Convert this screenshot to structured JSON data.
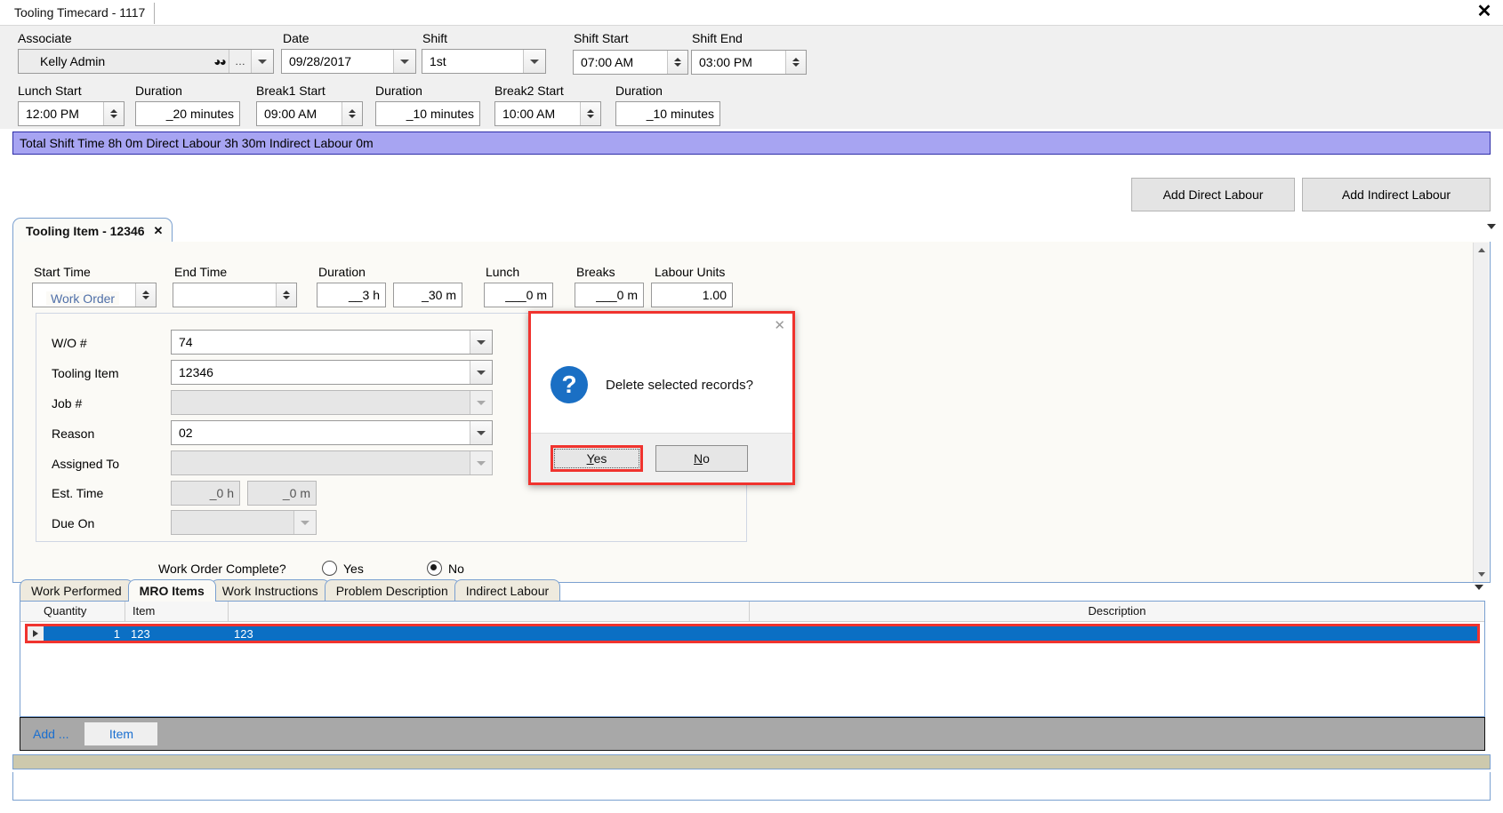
{
  "window": {
    "doc_tab_label": "Tooling Timecard - 1117",
    "close_icon": "close-icon"
  },
  "header": {
    "associate": {
      "label": "Associate",
      "value": "Kelly Admin"
    },
    "date": {
      "label": "Date",
      "value": "09/28/2017"
    },
    "shift": {
      "label": "Shift",
      "value": "1st"
    },
    "shift_start": {
      "label": "Shift Start",
      "value": "07:00 AM"
    },
    "shift_end": {
      "label": "Shift End",
      "value": "03:00 PM"
    },
    "lunch_start": {
      "label": "Lunch Start",
      "value": "12:00 PM"
    },
    "lunch_duration": {
      "label": "Duration",
      "value": "_20 minutes"
    },
    "break1_start": {
      "label": "Break1 Start",
      "value": "09:00 AM"
    },
    "break1_duration": {
      "label": "Duration",
      "value": "_10 minutes"
    },
    "break2_start": {
      "label": "Break2 Start",
      "value": "10:00 AM"
    },
    "break2_duration": {
      "label": "Duration",
      "value": "_10 minutes"
    }
  },
  "summary_banner": {
    "text": "Total Shift Time 8h 0m  Direct Labour 3h 30m  Indirect Labour 0m",
    "background": "#a7a4f2",
    "border": "#2e2ea8"
  },
  "actions": {
    "add_direct_labour": "Add Direct Labour",
    "add_indirect_labour": "Add Indirect Labour"
  },
  "inner_tab": {
    "label": "Tooling Item - 12346",
    "close_glyph": "✕"
  },
  "time_fields": {
    "start_time": {
      "label": "Start Time",
      "value": ""
    },
    "end_time": {
      "label": "End Time",
      "value": ""
    },
    "duration": {
      "label": "Duration",
      "hours": "__3 h",
      "minutes": "_30 m"
    },
    "lunch": {
      "label": "Lunch",
      "value": "___0 m"
    },
    "breaks": {
      "label": "Breaks",
      "value": "___0 m"
    },
    "labour_units": {
      "label": "Labour Units",
      "value": "1.00"
    }
  },
  "work_order": {
    "group_title": "Work Order",
    "fields": [
      {
        "label": "W/O #",
        "value": "74",
        "disabled": false
      },
      {
        "label": "Tooling Item",
        "value": "12346",
        "disabled": false
      },
      {
        "label": "Job #",
        "value": "",
        "disabled": true
      },
      {
        "label": "Reason",
        "value": "02",
        "disabled": false
      },
      {
        "label": "Assigned To",
        "value": "",
        "disabled": true
      }
    ],
    "est_time": {
      "label": "Est. Time",
      "hours": "_0 h",
      "minutes": "_0 m"
    },
    "due_on": {
      "label": "Due On",
      "value": ""
    },
    "complete": {
      "label": "Work Order Complete?",
      "yes_label": "Yes",
      "no_label": "No",
      "selected": "No"
    }
  },
  "bottom_tabs": [
    {
      "label": "Work Performed",
      "active": false
    },
    {
      "label": "MRO Items",
      "active": true
    },
    {
      "label": "Work Instructions",
      "active": false
    },
    {
      "label": "Problem Description",
      "active": false
    },
    {
      "label": "Indirect Labour",
      "active": false
    }
  ],
  "grid": {
    "columns": [
      "Quantity",
      "Item",
      "",
      "Description"
    ],
    "rows": [
      {
        "quantity": "1",
        "item": "123",
        "col3": "123",
        "description": ""
      }
    ],
    "selection_color": "#0b6fc4",
    "highlight_border": "#f0332e"
  },
  "add_bar": {
    "add_label": "Add ...",
    "item_button": "Item"
  },
  "dialog": {
    "message": "Delete selected records?",
    "icon": "question-icon",
    "yes": {
      "prefix": "",
      "accel": "Y",
      "rest": "es"
    },
    "no": {
      "prefix": "",
      "accel": "N",
      "rest": "o"
    },
    "close_glyph": "✕",
    "border_color": "#f0332e"
  }
}
